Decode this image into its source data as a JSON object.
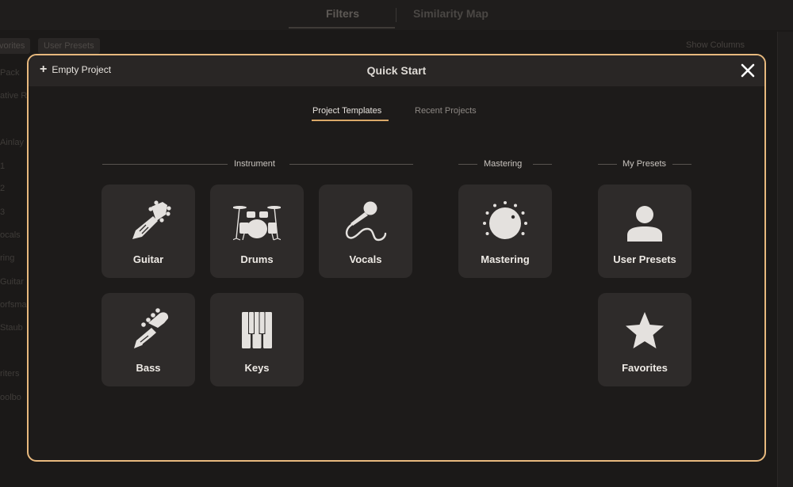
{
  "background": {
    "tabs": [
      "Filters",
      "Similarity Map"
    ],
    "chips": [
      "vorites",
      "User Presets"
    ],
    "show_columns": "Show Columns",
    "left_items": [
      "Pack",
      "ative R",
      "Ainlay",
      "1",
      "2",
      "3",
      "ocals",
      "ring",
      "Guitar",
      "orfsma",
      "Staub",
      "riters",
      "oolbo"
    ]
  },
  "modal": {
    "title": "Quick Start",
    "empty_project": "Empty Project",
    "tabs": [
      "Project Templates",
      "Recent Projects"
    ],
    "active_tab": "Project Templates"
  },
  "sections": {
    "instrument": "Instrument",
    "mastering": "Mastering",
    "my_presets": "My Presets"
  },
  "tiles": {
    "guitar": "Guitar",
    "drums": "Drums",
    "vocals": "Vocals",
    "bass": "Bass",
    "keys": "Keys",
    "mastering": "Mastering",
    "user_presets": "User Presets",
    "favorites": "Favorites"
  },
  "colors": {
    "accent": "#e8b97e",
    "tile_bg": "#2e2b2a",
    "modal_bg": "#1d1b1a",
    "icon": "#e4e1de"
  }
}
